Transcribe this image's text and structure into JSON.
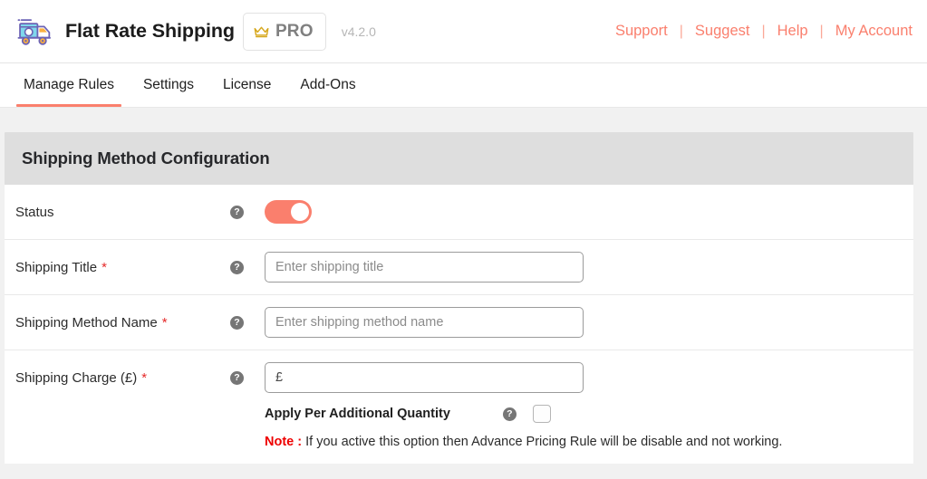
{
  "header": {
    "logo_icon": "delivery-truck-icon",
    "title": "Flat Rate Shipping",
    "pro_badge": {
      "icon": "crown-icon",
      "label": "PRO"
    },
    "version": "v4.2.0",
    "links": [
      {
        "label": "Support"
      },
      {
        "label": "Suggest"
      },
      {
        "label": "Help"
      },
      {
        "label": "My Account"
      }
    ],
    "link_separator": "|"
  },
  "tabs": [
    {
      "label": "Manage Rules",
      "active": true
    },
    {
      "label": "Settings",
      "active": false
    },
    {
      "label": "License",
      "active": false
    },
    {
      "label": "Add-Ons",
      "active": false
    }
  ],
  "panel": {
    "title": "Shipping Method Configuration",
    "help_icon_glyph": "?",
    "required_marker": "*",
    "rows": {
      "status": {
        "label": "Status",
        "toggle_on": true
      },
      "shipping_title": {
        "label": "Shipping Title",
        "required": true,
        "placeholder": "Enter shipping title",
        "value": ""
      },
      "shipping_method_name": {
        "label": "Shipping Method Name",
        "required": true,
        "placeholder": "Enter shipping method name",
        "value": ""
      },
      "shipping_charge": {
        "label": "Shipping Charge (£)",
        "required": true,
        "placeholder": "£",
        "value": "",
        "apply_per_additional_quantity": {
          "label": "Apply Per Additional Quantity",
          "checked": false
        },
        "note_prefix": "Note :",
        "note_text": " If you active this option then Advance Pricing Rule will be disable and not working."
      }
    }
  },
  "colors": {
    "accent": "#fa7f6d",
    "required_red": "#e52a2a",
    "note_red": "#ee0000",
    "panel_header_bg": "#dedede",
    "page_bg": "#f1f1f1"
  }
}
